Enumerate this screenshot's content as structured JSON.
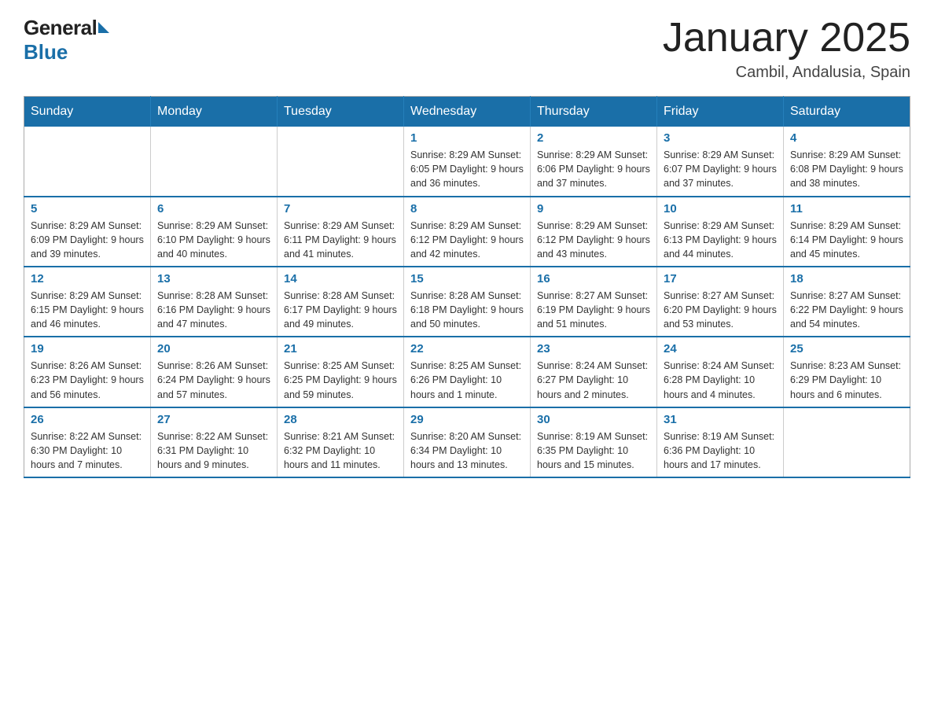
{
  "logo": {
    "general": "General",
    "blue": "Blue"
  },
  "title": {
    "month_year": "January 2025",
    "location": "Cambil, Andalusia, Spain"
  },
  "weekdays": [
    "Sunday",
    "Monday",
    "Tuesday",
    "Wednesday",
    "Thursday",
    "Friday",
    "Saturday"
  ],
  "weeks": [
    [
      {
        "day": "",
        "info": ""
      },
      {
        "day": "",
        "info": ""
      },
      {
        "day": "",
        "info": ""
      },
      {
        "day": "1",
        "info": "Sunrise: 8:29 AM\nSunset: 6:05 PM\nDaylight: 9 hours\nand 36 minutes."
      },
      {
        "day": "2",
        "info": "Sunrise: 8:29 AM\nSunset: 6:06 PM\nDaylight: 9 hours\nand 37 minutes."
      },
      {
        "day": "3",
        "info": "Sunrise: 8:29 AM\nSunset: 6:07 PM\nDaylight: 9 hours\nand 37 minutes."
      },
      {
        "day": "4",
        "info": "Sunrise: 8:29 AM\nSunset: 6:08 PM\nDaylight: 9 hours\nand 38 minutes."
      }
    ],
    [
      {
        "day": "5",
        "info": "Sunrise: 8:29 AM\nSunset: 6:09 PM\nDaylight: 9 hours\nand 39 minutes."
      },
      {
        "day": "6",
        "info": "Sunrise: 8:29 AM\nSunset: 6:10 PM\nDaylight: 9 hours\nand 40 minutes."
      },
      {
        "day": "7",
        "info": "Sunrise: 8:29 AM\nSunset: 6:11 PM\nDaylight: 9 hours\nand 41 minutes."
      },
      {
        "day": "8",
        "info": "Sunrise: 8:29 AM\nSunset: 6:12 PM\nDaylight: 9 hours\nand 42 minutes."
      },
      {
        "day": "9",
        "info": "Sunrise: 8:29 AM\nSunset: 6:12 PM\nDaylight: 9 hours\nand 43 minutes."
      },
      {
        "day": "10",
        "info": "Sunrise: 8:29 AM\nSunset: 6:13 PM\nDaylight: 9 hours\nand 44 minutes."
      },
      {
        "day": "11",
        "info": "Sunrise: 8:29 AM\nSunset: 6:14 PM\nDaylight: 9 hours\nand 45 minutes."
      }
    ],
    [
      {
        "day": "12",
        "info": "Sunrise: 8:29 AM\nSunset: 6:15 PM\nDaylight: 9 hours\nand 46 minutes."
      },
      {
        "day": "13",
        "info": "Sunrise: 8:28 AM\nSunset: 6:16 PM\nDaylight: 9 hours\nand 47 minutes."
      },
      {
        "day": "14",
        "info": "Sunrise: 8:28 AM\nSunset: 6:17 PM\nDaylight: 9 hours\nand 49 minutes."
      },
      {
        "day": "15",
        "info": "Sunrise: 8:28 AM\nSunset: 6:18 PM\nDaylight: 9 hours\nand 50 minutes."
      },
      {
        "day": "16",
        "info": "Sunrise: 8:27 AM\nSunset: 6:19 PM\nDaylight: 9 hours\nand 51 minutes."
      },
      {
        "day": "17",
        "info": "Sunrise: 8:27 AM\nSunset: 6:20 PM\nDaylight: 9 hours\nand 53 minutes."
      },
      {
        "day": "18",
        "info": "Sunrise: 8:27 AM\nSunset: 6:22 PM\nDaylight: 9 hours\nand 54 minutes."
      }
    ],
    [
      {
        "day": "19",
        "info": "Sunrise: 8:26 AM\nSunset: 6:23 PM\nDaylight: 9 hours\nand 56 minutes."
      },
      {
        "day": "20",
        "info": "Sunrise: 8:26 AM\nSunset: 6:24 PM\nDaylight: 9 hours\nand 57 minutes."
      },
      {
        "day": "21",
        "info": "Sunrise: 8:25 AM\nSunset: 6:25 PM\nDaylight: 9 hours\nand 59 minutes."
      },
      {
        "day": "22",
        "info": "Sunrise: 8:25 AM\nSunset: 6:26 PM\nDaylight: 10 hours\nand 1 minute."
      },
      {
        "day": "23",
        "info": "Sunrise: 8:24 AM\nSunset: 6:27 PM\nDaylight: 10 hours\nand 2 minutes."
      },
      {
        "day": "24",
        "info": "Sunrise: 8:24 AM\nSunset: 6:28 PM\nDaylight: 10 hours\nand 4 minutes."
      },
      {
        "day": "25",
        "info": "Sunrise: 8:23 AM\nSunset: 6:29 PM\nDaylight: 10 hours\nand 6 minutes."
      }
    ],
    [
      {
        "day": "26",
        "info": "Sunrise: 8:22 AM\nSunset: 6:30 PM\nDaylight: 10 hours\nand 7 minutes."
      },
      {
        "day": "27",
        "info": "Sunrise: 8:22 AM\nSunset: 6:31 PM\nDaylight: 10 hours\nand 9 minutes."
      },
      {
        "day": "28",
        "info": "Sunrise: 8:21 AM\nSunset: 6:32 PM\nDaylight: 10 hours\nand 11 minutes."
      },
      {
        "day": "29",
        "info": "Sunrise: 8:20 AM\nSunset: 6:34 PM\nDaylight: 10 hours\nand 13 minutes."
      },
      {
        "day": "30",
        "info": "Sunrise: 8:19 AM\nSunset: 6:35 PM\nDaylight: 10 hours\nand 15 minutes."
      },
      {
        "day": "31",
        "info": "Sunrise: 8:19 AM\nSunset: 6:36 PM\nDaylight: 10 hours\nand 17 minutes."
      },
      {
        "day": "",
        "info": ""
      }
    ]
  ]
}
